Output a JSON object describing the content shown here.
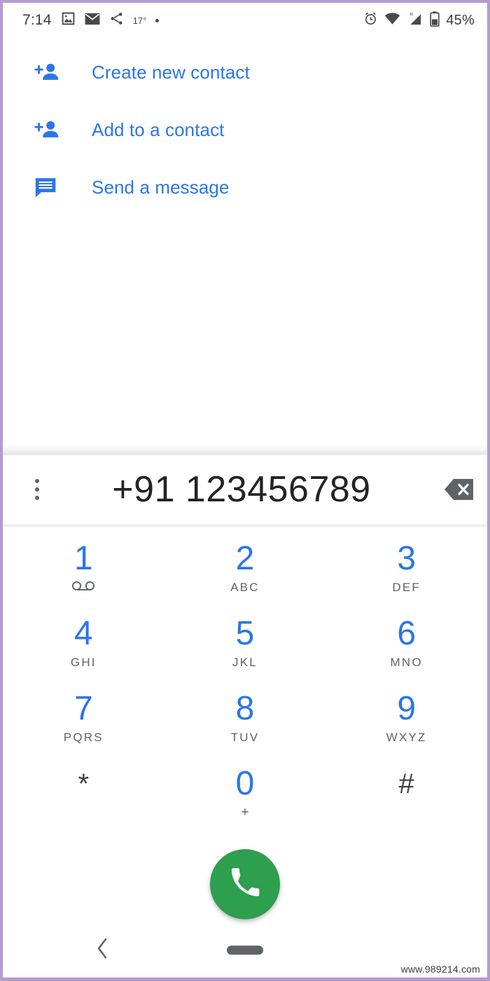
{
  "status_bar": {
    "time": "7:14",
    "temperature": "17°",
    "battery_percent": "45%",
    "left_icons": [
      "photo-icon",
      "email-icon",
      "share-icon",
      "dot-indicator-icon"
    ],
    "right_icons": [
      "alarm-icon",
      "wifi-icon",
      "signal-roaming-icon",
      "battery-icon"
    ]
  },
  "actions": [
    {
      "label": "Create new contact",
      "icon": "person-add-icon"
    },
    {
      "label": "Add to a contact",
      "icon": "person-add-icon"
    },
    {
      "label": "Send a message",
      "icon": "message-icon"
    }
  ],
  "dialer": {
    "number": "+91 123456789",
    "overflow_icon": "more-vertical-icon",
    "backspace_icon": "backspace-icon",
    "call_icon": "phone-call-icon",
    "keys": [
      {
        "digit": "1",
        "sub": "",
        "sub_icon": "voicemail-icon",
        "symbol": false
      },
      {
        "digit": "2",
        "sub": "ABC",
        "sub_icon": "",
        "symbol": false
      },
      {
        "digit": "3",
        "sub": "DEF",
        "sub_icon": "",
        "symbol": false
      },
      {
        "digit": "4",
        "sub": "GHI",
        "sub_icon": "",
        "symbol": false
      },
      {
        "digit": "5",
        "sub": "JKL",
        "sub_icon": "",
        "symbol": false
      },
      {
        "digit": "6",
        "sub": "MNO",
        "sub_icon": "",
        "symbol": false
      },
      {
        "digit": "7",
        "sub": "PQRS",
        "sub_icon": "",
        "symbol": false
      },
      {
        "digit": "8",
        "sub": "TUV",
        "sub_icon": "",
        "symbol": false
      },
      {
        "digit": "9",
        "sub": "WXYZ",
        "sub_icon": "",
        "symbol": false
      },
      {
        "digit": "*",
        "sub": "",
        "sub_icon": "",
        "symbol": true
      },
      {
        "digit": "0",
        "sub": "+",
        "sub_icon": "",
        "symbol": false
      },
      {
        "digit": "#",
        "sub": "",
        "sub_icon": "",
        "symbol": true
      }
    ]
  },
  "nav_bar": {
    "back_icon": "back-chevron-icon",
    "home_icon": "home-pill-icon"
  },
  "watermark": "www.989214.com",
  "colors": {
    "accent_blue": "#2a76e8",
    "call_green": "#2e9e4f",
    "text_dark": "#232323",
    "text_gray": "#5f6368",
    "page_border": "#b49bd2"
  }
}
